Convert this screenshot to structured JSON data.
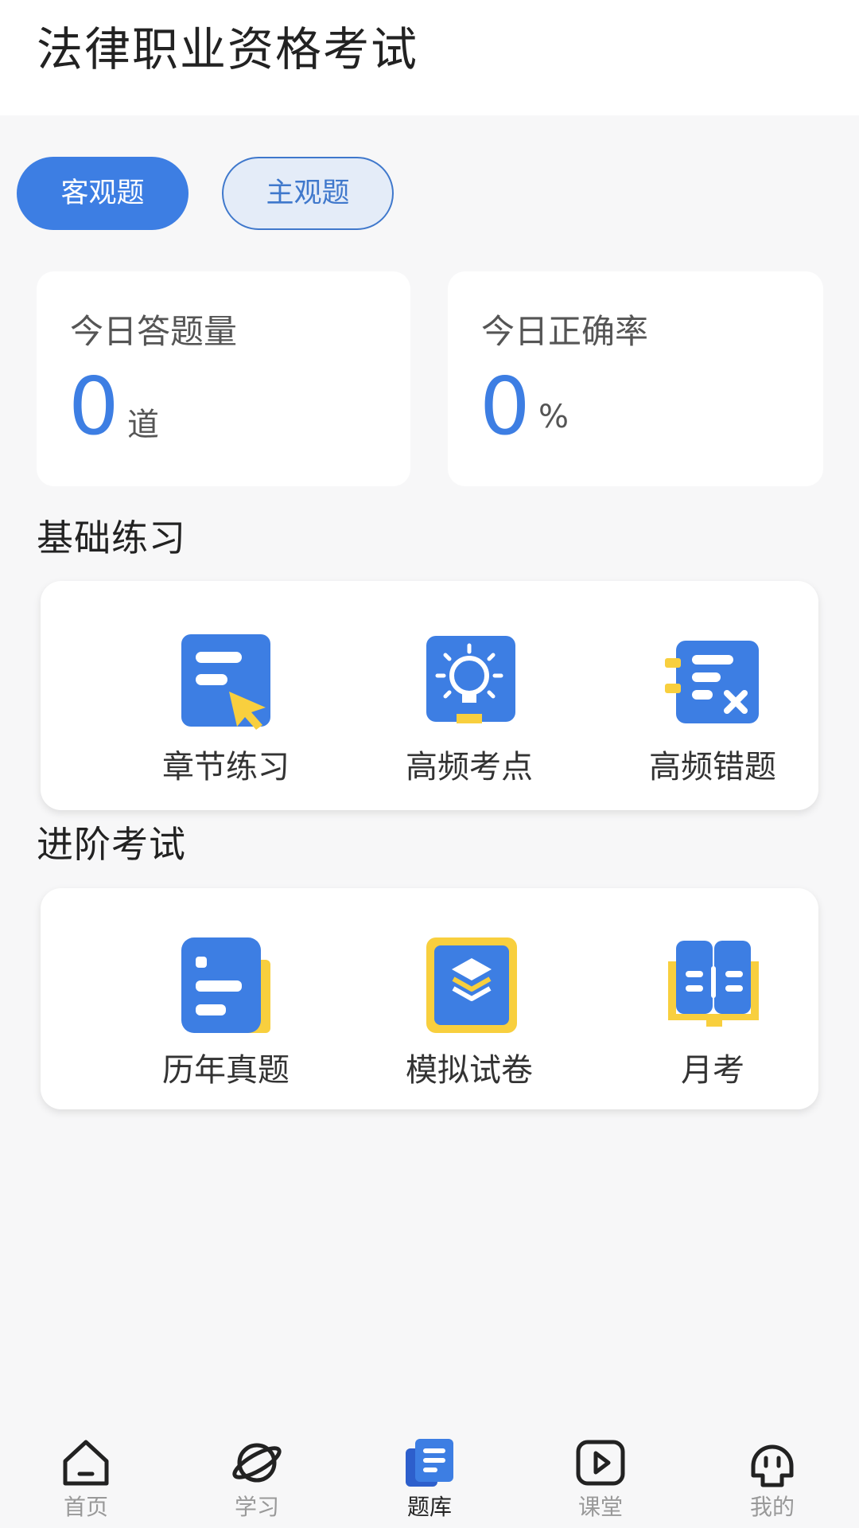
{
  "header": {
    "title": "法律职业资格考试"
  },
  "type_tabs": [
    {
      "label": "客观题",
      "active": true
    },
    {
      "label": "主观题",
      "active": false
    }
  ],
  "stats": [
    {
      "label": "今日答题量",
      "value": "0",
      "unit": "道"
    },
    {
      "label": "今日正确率",
      "value": "0",
      "unit": "%"
    }
  ],
  "sections": {
    "basic": {
      "title": "基础练习",
      "items": [
        {
          "label": "章节练习",
          "icon": "chapter-practice-icon"
        },
        {
          "label": "高频考点",
          "icon": "lightbulb-icon"
        },
        {
          "label": "高频错题",
          "icon": "wrong-questions-icon"
        }
      ]
    },
    "advanced": {
      "title": "进阶考试",
      "items": [
        {
          "label": "历年真题",
          "icon": "past-papers-icon"
        },
        {
          "label": "模拟试卷",
          "icon": "mock-exam-icon"
        },
        {
          "label": "月考",
          "icon": "monthly-exam-icon"
        }
      ]
    }
  },
  "tabbar": [
    {
      "label": "首页",
      "icon": "home-icon",
      "active": false
    },
    {
      "label": "学习",
      "icon": "planet-icon",
      "active": false
    },
    {
      "label": "题库",
      "icon": "question-bank-icon",
      "active": true
    },
    {
      "label": "课堂",
      "icon": "play-icon",
      "active": false
    },
    {
      "label": "我的",
      "icon": "profile-icon",
      "active": false
    }
  ],
  "colors": {
    "accent": "#3d7ee3",
    "accent_yellow": "#f8cf3e",
    "background": "#f7f7f8"
  }
}
